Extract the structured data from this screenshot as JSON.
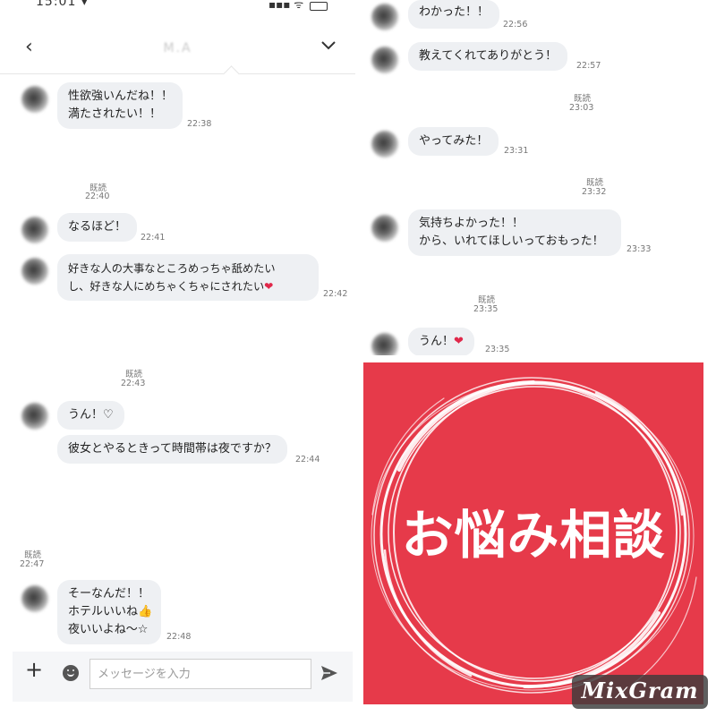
{
  "left_panel": {
    "status_bar": {
      "time": "15:01 ▾",
      "signal": "▪▪▪ ᯤ"
    },
    "header": {
      "title": "M.A"
    },
    "messages": [
      {
        "lines": [
          "性欲強いんだね！！",
          "満たされたい！！"
        ],
        "time": "22:38"
      },
      {
        "read": "既読",
        "read_time": "22:40"
      },
      {
        "lines": [
          "なるほど！"
        ],
        "time": "22:41"
      },
      {
        "lines": [
          "好きな人の大事なところめっちゃ舐めたい",
          "し、好きな人にめちゃくちゃにされたい"
        ],
        "emoji": "❤",
        "time": "22:42"
      },
      {
        "read": "既読",
        "read_time": "22:43"
      },
      {
        "lines": [
          "うん！♡"
        ]
      },
      {
        "lines": [
          "彼女とやるときって時間帯は夜ですか？"
        ],
        "time": "22:44"
      },
      {
        "read": "既読",
        "read_time": "22:47"
      },
      {
        "lines": [
          "そーなんだ！！",
          "ホテルいいね",
          "夜いいよね〜☆"
        ],
        "emoji": "👍",
        "time": "22:48"
      }
    ],
    "composer": {
      "placeholder": "メッセージを入力"
    }
  },
  "right_top_panel": {
    "messages": [
      {
        "lines": [
          "わかった！！"
        ],
        "time": "22:56"
      },
      {
        "lines": [
          "教えてくれてありがとう！"
        ],
        "time": "22:57"
      },
      {
        "read": "既読",
        "read_time": "23:03"
      },
      {
        "lines": [
          "やってみた！"
        ],
        "time": "23:31"
      },
      {
        "read": "既読",
        "read_time": "23:32"
      },
      {
        "lines": [
          "気持ちよかった！！",
          "から、いれてほしいっておもった！"
        ],
        "time": "23:33"
      },
      {
        "read": "既読",
        "read_time": "23:35"
      },
      {
        "lines": [
          "うん！"
        ],
        "emoji": "❤",
        "time": "23:35"
      }
    ]
  },
  "banner": {
    "title": "お悩み相談",
    "background_color": "#e63a4a",
    "ring_color": "#ffffff"
  },
  "watermark": {
    "text": "MixGram"
  }
}
